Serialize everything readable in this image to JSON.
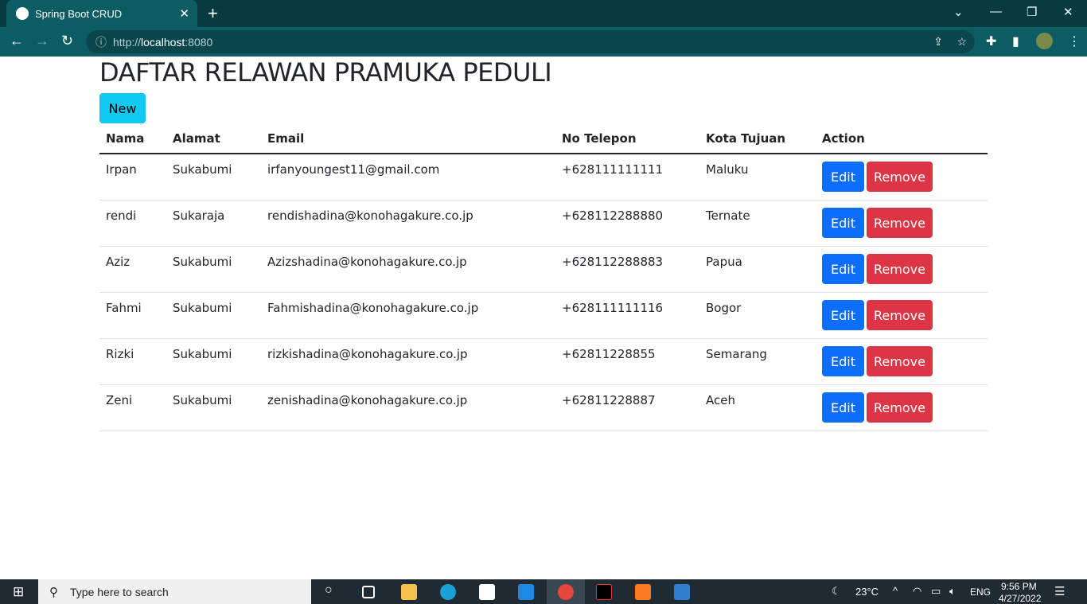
{
  "browser": {
    "tab_title": "Spring Boot CRUD",
    "url_prefix": "http://",
    "url_host": "localhost",
    "url_port": ":8080"
  },
  "page": {
    "title": "DAFTAR RELAWAN PRAMUKA PEDULI",
    "new_label": "New"
  },
  "table": {
    "headers": [
      "Nama",
      "Alamat",
      "Email",
      "No Telepon",
      "Kota Tujuan",
      "Action"
    ],
    "rows": [
      [
        "Irpan",
        "Sukabumi",
        "irfanyoungest11@gmail.com",
        "+628111111111",
        "Maluku"
      ],
      [
        "rendi",
        "Sukaraja",
        "rendishadina@konohagakure.co.jp",
        "+628112288880",
        "Ternate"
      ],
      [
        "Aziz",
        "Sukabumi",
        "Azizshadina@konohagakure.co.jp",
        "+628112288883",
        "Papua"
      ],
      [
        "Fahmi",
        "Sukabumi",
        "Fahmishadina@konohagakure.co.jp",
        "+628111111116",
        "Bogor"
      ],
      [
        "Rizki",
        "Sukabumi",
        "rizkishadina@konohagakure.co.jp",
        "+62811228855",
        "Semarang"
      ],
      [
        "Zeni",
        "Sukabumi",
        "zenishadina@konohagakure.co.jp",
        "+62811228887",
        "Aceh"
      ]
    ],
    "edit_label": "Edit",
    "remove_label": "Remove"
  },
  "taskbar": {
    "search_placeholder": "Type here to search",
    "weather": "23°C",
    "lang": "ENG",
    "time": "9:56 PM",
    "date": "4/27/2022"
  },
  "colors": {
    "info": "#0dcaf0",
    "primary": "#0d6efd",
    "danger": "#dc3545"
  }
}
